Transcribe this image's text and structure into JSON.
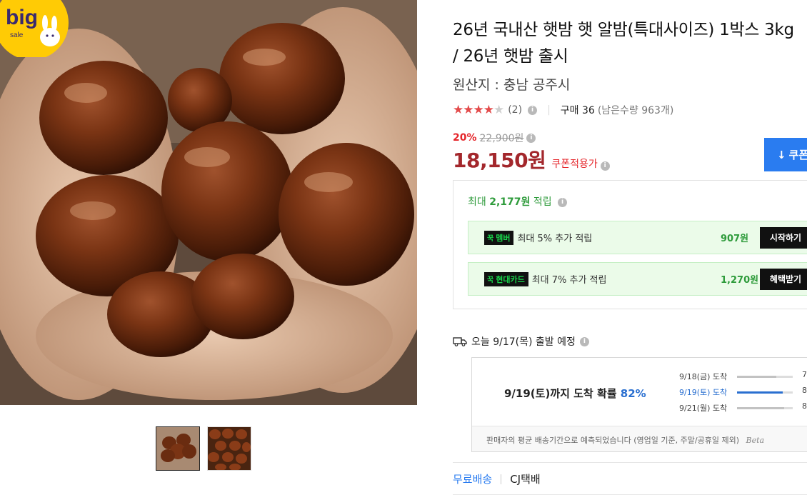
{
  "product": {
    "title": "26년 국내산 햇밤 햇 알밤(특대사이즈) 1박스 3kg / 26년 햇밤 출시",
    "origin": "원산지 : 충남 공주시",
    "rating": {
      "stars_filled": 4,
      "stars_total": 5,
      "review_count": "(2)"
    },
    "purchase_count": "구매 36",
    "remaining": "(남은수량 963개)",
    "discount_rate": "20%",
    "original_price": "22,900원",
    "sale_price": "18,150원",
    "coupon_applied_label": "쿠폰적용가",
    "coupon_button_label": "쿠폰"
  },
  "badge": {
    "text": "big",
    "subtext": "sale"
  },
  "thumbnails": [
    "thumbnail-1",
    "thumbnail-2"
  ],
  "points": {
    "head_prefix": "최대",
    "head_amount": "2,177원",
    "head_suffix": "적립",
    "rows": [
      {
        "tag_prefix": "꾹",
        "tag": "멤버",
        "text": "최대 5% 추가 적립",
        "amount": "907원",
        "button": "시작하기"
      },
      {
        "tag_prefix": "꾹",
        "tag": "현대카드",
        "text": "최대 7% 추가 적립",
        "amount": "1,270원",
        "button": "혜택받기"
      }
    ]
  },
  "shipping": {
    "departure": "오늘 9/17(목) 출발 예정",
    "arrival_main": "9/19(토)까지 도착 확률",
    "arrival_pct": "82%",
    "lines": [
      {
        "date": "9/18(금) 도착",
        "value": "7",
        "fill": 0.7
      },
      {
        "date": "9/19(토) 도착",
        "value": "8",
        "fill": 0.82
      },
      {
        "date": "9/21(월) 도착",
        "value": "8",
        "fill": 0.85
      }
    ],
    "note": "판매자의 평균 배송기간으로 예측되었습니다 (영업일 기준, 주말/공휴일 제외)",
    "beta": "Beta",
    "free_shipping": "무료배송",
    "carrier": "CJ택배"
  },
  "colors": {
    "price": "#a3272c",
    "discount": "#e5252a",
    "accent_blue": "#2a7cf0",
    "points_green": "#2e9b3b"
  }
}
